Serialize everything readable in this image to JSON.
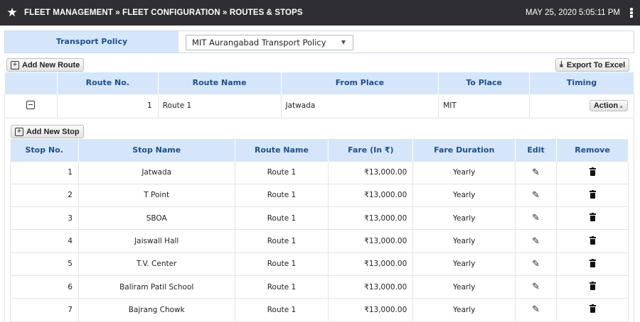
{
  "header": {
    "breadcrumb": "FLEET MANAGEMENT » FLEET CONFIGURATION » ROUTES & STOPS",
    "datetime": "MAY 25, 2020  5:05:11 PM"
  },
  "policy": {
    "label": "Transport Policy",
    "selected": "MIT Aurangabad Transport Policy"
  },
  "buttons": {
    "add_route": "Add New Route",
    "export": "Export To Excel",
    "add_stop": "Add New Stop",
    "action": "Action"
  },
  "route_table": {
    "columns": [
      "Route No.",
      "Route Name",
      "From Place",
      "To Place",
      "Timing"
    ],
    "rows": [
      {
        "route_no": "1",
        "route_name": "Route 1",
        "from": "Jatwada",
        "to": "MIT",
        "timing": ""
      }
    ]
  },
  "stop_table": {
    "columns": [
      "Stop No.",
      "Stop Name",
      "Route Name",
      "Fare (In ₹)",
      "Fare Duration",
      "Edit",
      "Remove"
    ],
    "rows": [
      {
        "no": "1",
        "name": "Jatwada",
        "route": "Route 1",
        "fare": "₹13,000.00",
        "duration": "Yearly"
      },
      {
        "no": "2",
        "name": "T Point",
        "route": "Route 1",
        "fare": "₹13,000.00",
        "duration": "Yearly"
      },
      {
        "no": "3",
        "name": "SBOA",
        "route": "Route 1",
        "fare": "₹13,000.00",
        "duration": "Yearly"
      },
      {
        "no": "4",
        "name": "Jaiswall Hall",
        "route": "Route 1",
        "fare": "₹13,000.00",
        "duration": "Yearly"
      },
      {
        "no": "5",
        "name": "T.V. Center",
        "route": "Route 1",
        "fare": "₹13,000.00",
        "duration": "Yearly"
      },
      {
        "no": "6",
        "name": "Baliram Patil School",
        "route": "Route 1",
        "fare": "₹13,000.00",
        "duration": "Yearly"
      },
      {
        "no": "7",
        "name": "Bajrang Chowk",
        "route": "Route 1",
        "fare": "₹13,000.00",
        "duration": "Yearly"
      }
    ]
  },
  "icons": {
    "header": "star-icon",
    "menu": "kebab-menu-icon",
    "add": "plus-square-icon",
    "collapse": "minus-square-icon",
    "export": "download-icon",
    "edit": "pencil-icon",
    "remove": "trash-icon"
  },
  "colors": {
    "topbar": "#2f2f33",
    "header_bg": "#d6e6fa",
    "header_text": "#1d4f8c"
  }
}
